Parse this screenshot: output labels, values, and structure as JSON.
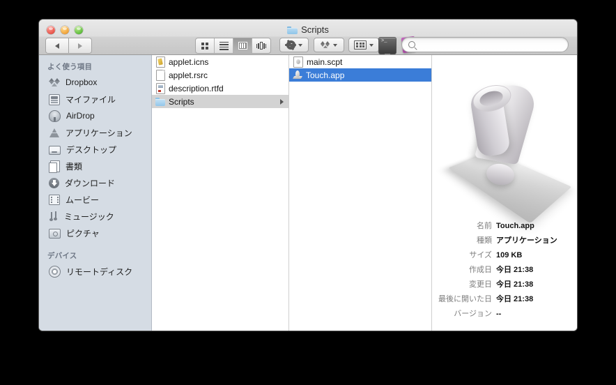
{
  "window": {
    "title": "Scripts",
    "title_icon": "folder-icon",
    "traffic_lights": [
      "close",
      "minimize",
      "zoom"
    ]
  },
  "toolbar": {
    "back_label": "◀",
    "forward_label": "▶",
    "view_modes": [
      {
        "name": "icon-view",
        "active": false
      },
      {
        "name": "list-view",
        "active": false
      },
      {
        "name": "column-view",
        "active": true
      },
      {
        "name": "coverflow-view",
        "active": false
      }
    ],
    "action_button": "gear-icon",
    "dropbox_button": "dropbox-icon",
    "arrange_button": "arrange-icon",
    "terminal_button": "terminal-icon",
    "script_editor_button": "applescript-editor-icon"
  },
  "search": {
    "placeholder": "",
    "value": "",
    "icon": "search-icon"
  },
  "sidebar": {
    "sections": [
      {
        "header": "よく使う項目",
        "items": [
          {
            "label": "Dropbox",
            "icon": "dropbox-icon"
          },
          {
            "label": "マイファイル",
            "icon": "my-files-icon"
          },
          {
            "label": "AirDrop",
            "icon": "airdrop-icon"
          },
          {
            "label": "アプリケーション",
            "icon": "applications-icon"
          },
          {
            "label": "デスクトップ",
            "icon": "desktop-icon"
          },
          {
            "label": "書類",
            "icon": "documents-icon"
          },
          {
            "label": "ダウンロード",
            "icon": "downloads-icon"
          },
          {
            "label": "ムービー",
            "icon": "movies-icon"
          },
          {
            "label": "ミュージック",
            "icon": "music-icon"
          },
          {
            "label": "ピクチャ",
            "icon": "pictures-icon"
          }
        ]
      },
      {
        "header": "デバイス",
        "items": [
          {
            "label": "リモートディスク",
            "icon": "remote-disc-icon"
          }
        ]
      }
    ]
  },
  "columns": [
    {
      "name": "column-one",
      "items": [
        {
          "label": "applet.icns",
          "icon": "icns-file-icon",
          "selected": false,
          "has_children": false
        },
        {
          "label": "applet.rsrc",
          "icon": "generic-file-icon",
          "selected": false,
          "has_children": false
        },
        {
          "label": "description.rtfd",
          "icon": "rtfd-file-icon",
          "selected": false,
          "has_children": false
        },
        {
          "label": "Scripts",
          "icon": "folder-icon",
          "selected": true,
          "selection": "inactive",
          "has_children": true
        }
      ]
    },
    {
      "name": "column-two",
      "items": [
        {
          "label": "main.scpt",
          "icon": "script-file-icon",
          "selected": false,
          "has_children": false
        },
        {
          "label": "Touch.app",
          "icon": "application-icon",
          "selected": true,
          "selection": "active",
          "has_children": false
        }
      ]
    }
  ],
  "preview": {
    "icon": "applescript-app-icon",
    "metadata": [
      {
        "label": "名前",
        "value": "Touch.app"
      },
      {
        "label": "種類",
        "value": "アプリケーション"
      },
      {
        "label": "サイズ",
        "value": "109 KB"
      },
      {
        "label": "作成日",
        "value": "今日 21:38"
      },
      {
        "label": "変更日",
        "value": "今日 21:38"
      },
      {
        "label": "最後に開いた日",
        "value": "今日 21:38"
      },
      {
        "label": "バージョン",
        "value": "--"
      }
    ]
  },
  "colors": {
    "selection_active": "#3b7dd8",
    "selection_inactive": "#d3d3d3",
    "sidebar_bg": "#d5dce4",
    "desktop_bg": "#000000"
  }
}
